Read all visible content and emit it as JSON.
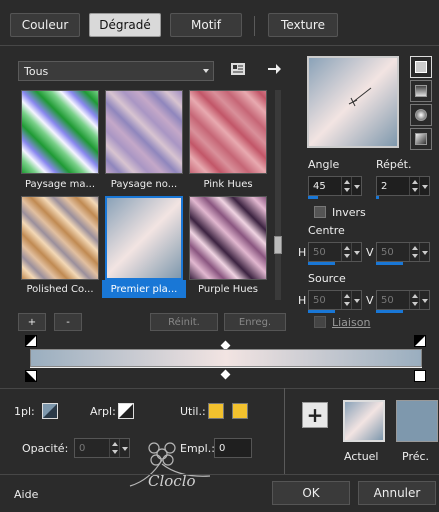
{
  "tabs": [
    {
      "label": "Couleur",
      "active": false
    },
    {
      "label": "Dégradé",
      "active": true
    },
    {
      "label": "Motif",
      "active": false
    },
    {
      "label": "Texture",
      "active": false
    }
  ],
  "category_select": {
    "value": "Tous"
  },
  "gradients": [
    {
      "label": "Paysage ma...",
      "selected": false
    },
    {
      "label": "Paysage no...",
      "selected": false
    },
    {
      "label": "Pink Hues",
      "selected": false
    },
    {
      "label": "Polished Co...",
      "selected": false
    },
    {
      "label": "Premier pla...",
      "selected": true
    },
    {
      "label": "Purple Hues",
      "selected": false
    }
  ],
  "library_buttons": {
    "add": "+",
    "remove": "-",
    "reset": "Réinit.",
    "save": "Enreg."
  },
  "angle": {
    "label": "Angle",
    "value": "45"
  },
  "repeat": {
    "label": "Répét.",
    "value": "2"
  },
  "invert": {
    "label": "Invers",
    "checked": false
  },
  "center": {
    "label": "Centre",
    "h_label": "H",
    "h_value": "50",
    "v_label": "V",
    "v_value": "50"
  },
  "source": {
    "label": "Source",
    "h_label": "H",
    "h_value": "50",
    "v_label": "V",
    "v_value": "50"
  },
  "link": {
    "label": "Liaison",
    "checked": false
  },
  "stop_controls": {
    "stop1_label": "1pl:",
    "arrow_label": "Arpl:",
    "util_label": "Util.:",
    "opacity_label": "Opacité:",
    "opacity_value": "0",
    "position_label": "Empl.:",
    "position_value": "0",
    "util_color_1": "#f2c12e",
    "util_color_2": "#f2c12e"
  },
  "preview": {
    "current_label": "Actuel",
    "previous_label": "Préc.",
    "add_icon": "+"
  },
  "footer": {
    "help": "Aide",
    "ok": "OK",
    "cancel": "Annuler"
  },
  "watermark": {
    "text": "Cloclo"
  },
  "colors": {
    "accent": "#1977d6",
    "gradient_start": "#9aaebf",
    "gradient_mid": "#f2e4e2",
    "gradient_end": "#7e98ad"
  }
}
